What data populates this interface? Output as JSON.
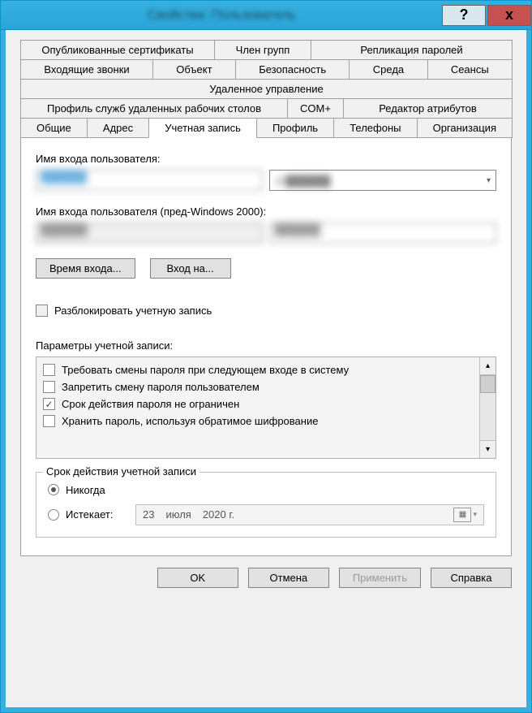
{
  "titlebar": {
    "title_blurred": "Свойства: Пользователь",
    "help": "?",
    "close": "x"
  },
  "tabs": {
    "row1": [
      "Опубликованные сертификаты",
      "Член групп",
      "Репликация паролей"
    ],
    "row2": [
      "Входящие звонки",
      "Объект",
      "Безопасность",
      "Среда",
      "Сеансы"
    ],
    "row3": [
      "Удаленное управление"
    ],
    "row4": [
      "Профиль служб удаленных рабочих столов",
      "COM+",
      "Редактор атрибутов"
    ],
    "row5": [
      "Общие",
      "Адрес",
      "Учетная запись",
      "Профиль",
      "Телефоны",
      "Организация"
    ]
  },
  "account": {
    "upn_label": "Имя входа пользователя:",
    "upn_value": "██████",
    "upn_suffix": "@██████",
    "sam_label": "Имя входа пользователя (пред-Windows 2000):",
    "sam_domain": "██████\\",
    "sam_value": "██████",
    "logon_hours_btn": "Время входа...",
    "logon_to_btn": "Вход на...",
    "unlock_label": "Разблокировать учетную запись",
    "options_label": "Параметры учетной записи:",
    "options": [
      {
        "label": "Требовать смены пароля при следующем входе в систему",
        "checked": false
      },
      {
        "label": "Запретить смену пароля пользователем",
        "checked": false
      },
      {
        "label": "Срок действия пароля не ограничен",
        "checked": true
      },
      {
        "label": "Хранить пароль, используя обратимое шифрование",
        "checked": false
      }
    ],
    "expiry_legend": "Срок действия учетной записи",
    "expiry_never": "Никогда",
    "expiry_on": "Истекает:",
    "expiry_date": {
      "day": "23",
      "month": "июля",
      "year": "2020 г."
    }
  },
  "footer": {
    "ok": "OK",
    "cancel": "Отмена",
    "apply": "Применить",
    "help": "Справка"
  }
}
